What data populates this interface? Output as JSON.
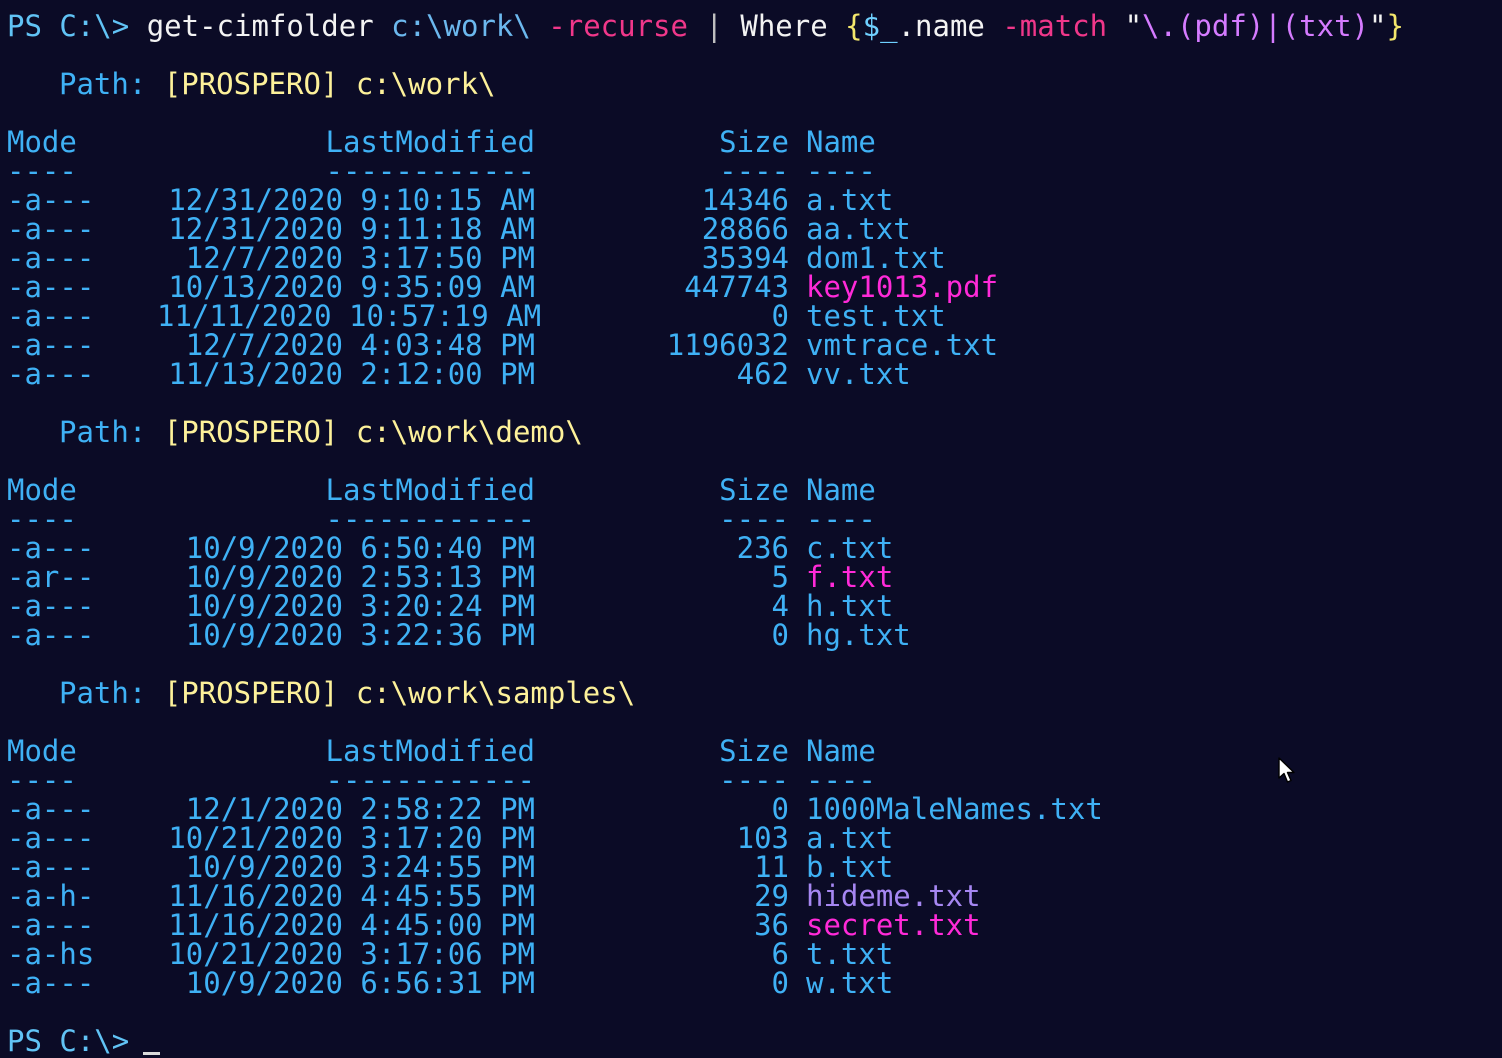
{
  "command": {
    "prompt": "PS C:\\>",
    "cmdlet": "get-cimfolder",
    "path_arg": "c:\\work\\",
    "param": "-recurse",
    "pipe": "|",
    "where": "Where",
    "open_brace": "{",
    "var": "$_",
    "member": ".name",
    "match": "-match",
    "quote_open": "\"",
    "regex": "\\.(pdf)|(txt)",
    "quote_close": "\"",
    "close_brace": "}"
  },
  "columns": {
    "mode": "Mode",
    "last_modified": "LastModified",
    "size": "Size",
    "name": "Name",
    "mode_rule": "----",
    "last_modified_rule": "------------",
    "size_rule": "----",
    "name_rule": "----"
  },
  "path_label": "Path:",
  "sections": [
    {
      "path": "[PROSPERO] c:\\work\\",
      "rows": [
        {
          "mode": "-a---",
          "date": "12/31/2020 9:10:15 AM",
          "size": "14346",
          "name": "a.txt",
          "color": "normal"
        },
        {
          "mode": "-a---",
          "date": "12/31/2020 9:11:18 AM",
          "size": "28866",
          "name": "aa.txt",
          "color": "normal"
        },
        {
          "mode": "-a---",
          "date": "12/7/2020 3:17:50 PM",
          "size": "35394",
          "name": "dom1.txt",
          "color": "normal"
        },
        {
          "mode": "-a---",
          "date": "10/13/2020 9:35:09 AM",
          "size": "447743",
          "name": "key1013.pdf",
          "color": "magenta"
        },
        {
          "mode": "-a---",
          "date": "11/11/2020 10:57:19 AM",
          "size": "0",
          "name": "test.txt",
          "color": "normal"
        },
        {
          "mode": "-a---",
          "date": "12/7/2020 4:03:48 PM",
          "size": "1196032",
          "name": "vmtrace.txt",
          "color": "normal"
        },
        {
          "mode": "-a---",
          "date": "11/13/2020 2:12:00 PM",
          "size": "462",
          "name": "vv.txt",
          "color": "normal"
        }
      ]
    },
    {
      "path": "[PROSPERO] c:\\work\\demo\\",
      "rows": [
        {
          "mode": "-a---",
          "date": "10/9/2020 6:50:40 PM",
          "size": "236",
          "name": "c.txt",
          "color": "normal"
        },
        {
          "mode": "-ar--",
          "date": "10/9/2020 2:53:13 PM",
          "size": "5",
          "name": "f.txt",
          "color": "magenta"
        },
        {
          "mode": "-a---",
          "date": "10/9/2020 3:20:24 PM",
          "size": "4",
          "name": "h.txt",
          "color": "normal"
        },
        {
          "mode": "-a---",
          "date": "10/9/2020 3:22:36 PM",
          "size": "0",
          "name": "hg.txt",
          "color": "normal"
        }
      ]
    },
    {
      "path": "[PROSPERO] c:\\work\\samples\\",
      "rows": [
        {
          "mode": "-a---",
          "date": "12/1/2020 2:58:22 PM",
          "size": "0",
          "name": "1000MaleNames.txt",
          "color": "normal"
        },
        {
          "mode": "-a---",
          "date": "10/21/2020 3:17:20 PM",
          "size": "103",
          "name": "a.txt",
          "color": "normal"
        },
        {
          "mode": "-a---",
          "date": "10/9/2020 3:24:55 PM",
          "size": "11",
          "name": "b.txt",
          "color": "normal"
        },
        {
          "mode": "-a-h-",
          "date": "11/16/2020 4:45:55 PM",
          "size": "29",
          "name": "hideme.txt",
          "color": "purple"
        },
        {
          "mode": "-a---",
          "date": "11/16/2020 4:45:00 PM",
          "size": "36",
          "name": "secret.txt",
          "color": "magenta"
        },
        {
          "mode": "-a-hs",
          "date": "10/21/2020 3:17:06 PM",
          "size": "6",
          "name": "t.txt",
          "color": "normal"
        },
        {
          "mode": "-a---",
          "date": "10/9/2020 6:56:31 PM",
          "size": "0",
          "name": "w.txt",
          "color": "normal"
        }
      ]
    }
  ],
  "final_prompt": "PS C:\\>",
  "colors": {
    "background": "#0b0b26",
    "table_text": "#3fb1f5",
    "path_value": "#fdf19a",
    "highlight_magenta": "#ff2ad8",
    "highlight_purple": "#a687f2",
    "param": "#f0378a"
  },
  "icons": [
    "mouse-pointer-icon",
    "text-cursor-icon"
  ]
}
